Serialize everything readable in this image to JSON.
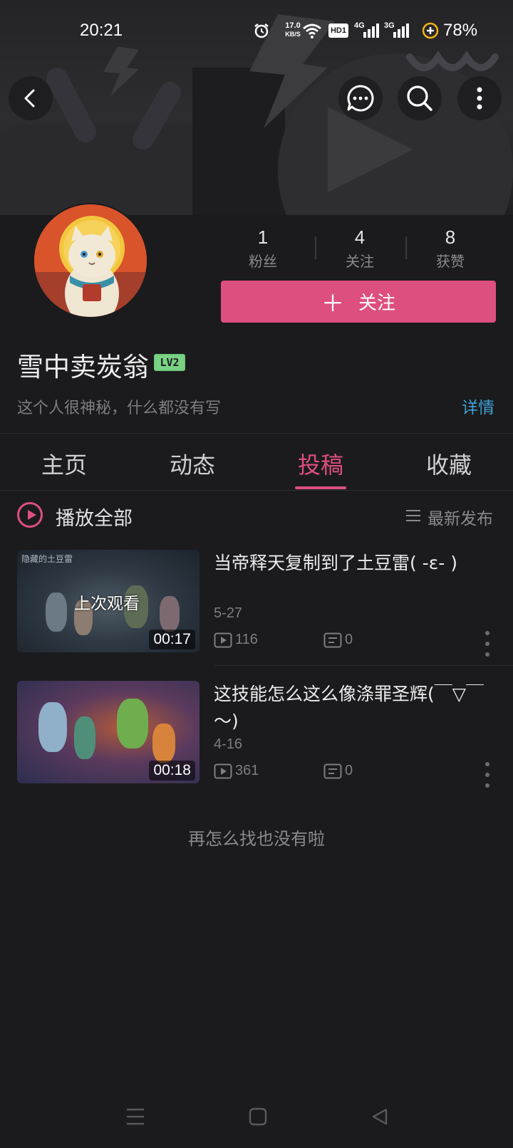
{
  "status_bar": {
    "time": "20:21",
    "net_speed_value": "17.0",
    "net_speed_unit": "KB/S",
    "hd_label": "HD1",
    "signal1_label": "4G",
    "signal2_label": "3G",
    "battery": "78%",
    "icons": [
      "alarm-icon",
      "wifi-icon",
      "signal-icon",
      "battery-saver-icon"
    ]
  },
  "top_nav": {
    "icons": [
      "back-arrow-icon",
      "message-icon",
      "search-icon",
      "more-vertical-icon"
    ]
  },
  "profile": {
    "stats": [
      {
        "value": "1",
        "label": "粉丝"
      },
      {
        "value": "4",
        "label": "关注"
      },
      {
        "value": "8",
        "label": "获赞"
      }
    ],
    "follow_label": "关注",
    "username": "雪中卖炭翁",
    "level": "LV2",
    "bio": "这个人很神秘，什么都没有写",
    "details_label": "详情"
  },
  "tabs": [
    {
      "label": "主页",
      "active": false
    },
    {
      "label": "动态",
      "active": false
    },
    {
      "label": "投稿",
      "active": true
    },
    {
      "label": "收藏",
      "active": false
    }
  ],
  "toolbar": {
    "play_all_label": "播放全部",
    "sort_label": "最新发布"
  },
  "videos": [
    {
      "title": "当帝释天复制到了土豆雷( ‑ɛ‑ )",
      "date": "5-27",
      "views": "116",
      "comments": "0",
      "duration": "00:17",
      "watched_label": "上次观看",
      "thumb_text": "隐藏的土豆雷"
    },
    {
      "title": "这技能怎么这么像涤罪圣辉(￣▽￣～)",
      "date": "4-16",
      "views": "361",
      "comments": "0",
      "duration": "00:18"
    }
  ],
  "end_message": "再怎么找也没有啦",
  "colors": {
    "accent": "#dd4f7e",
    "background": "#1b1b1d",
    "link": "#3ea0d4",
    "level_badge": "#7ad285"
  }
}
